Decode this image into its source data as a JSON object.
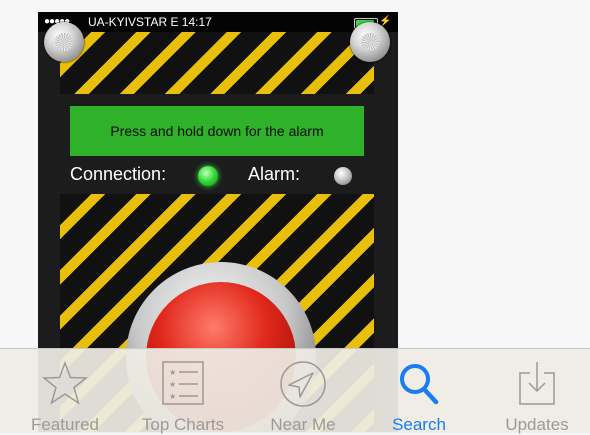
{
  "status_bar": {
    "signal": "●●●●●",
    "carrier": "UA-KYIVSTAR  E  14:17",
    "battery_color": "#3cd84b"
  },
  "app": {
    "banner_text": "Press and hold down for the alarm",
    "connection_label": "Connection:",
    "alarm_label": "Alarm:",
    "connection_led_color": "#38e03a",
    "alarm_led_color": "#bdbdbd",
    "stripe_colors": [
      "#111111",
      "#e8c00c"
    ],
    "button_color": "#e0281b"
  },
  "tab_bar": {
    "active_color": "#1a7cf0",
    "inactive_color": "#9a9a9a",
    "tabs": [
      {
        "label": "Featured",
        "icon": "star-icon",
        "active": false
      },
      {
        "label": "Top Charts",
        "icon": "list-icon",
        "active": false
      },
      {
        "label": "Near Me",
        "icon": "location-arrow-icon",
        "active": false
      },
      {
        "label": "Search",
        "icon": "search-icon",
        "active": true
      },
      {
        "label": "Updates",
        "icon": "download-tray-icon",
        "active": false
      }
    ]
  }
}
